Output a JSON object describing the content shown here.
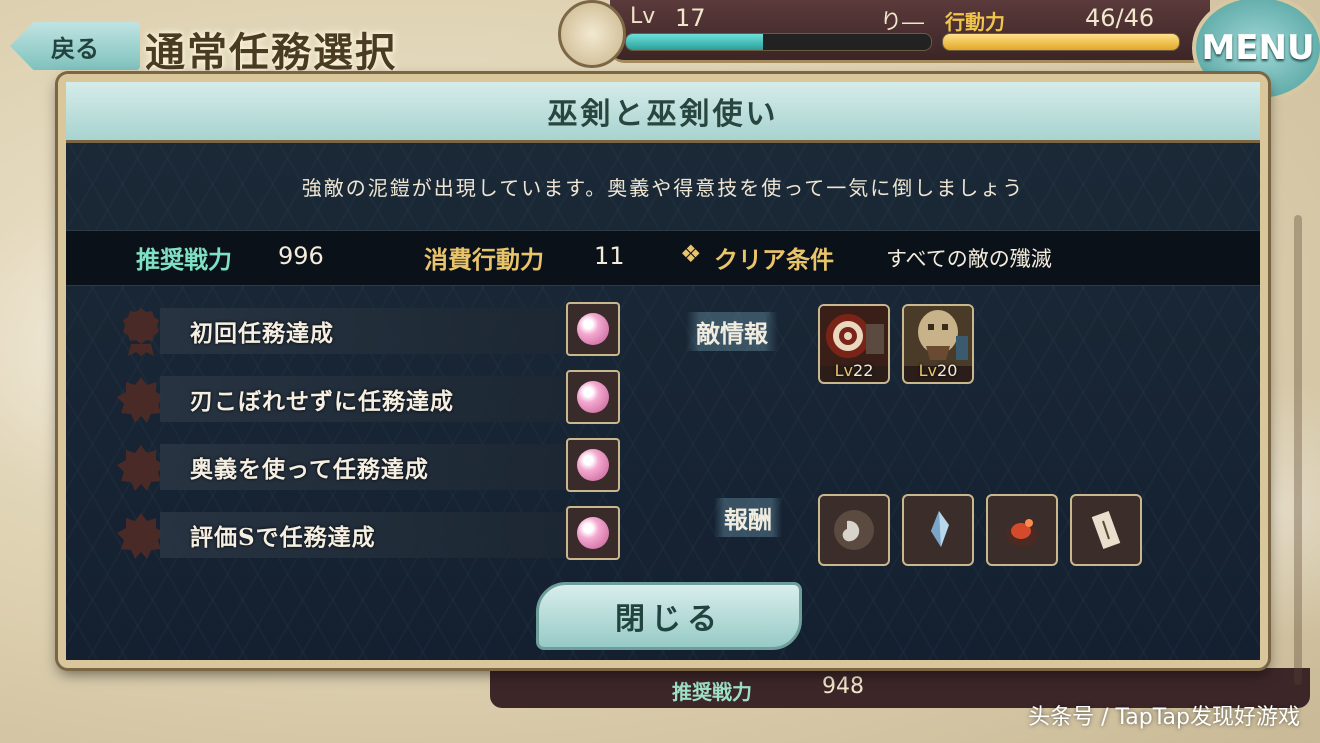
{
  "header": {
    "back_label": "戻る",
    "title": "通常任務選択",
    "level_label": "Lv",
    "level_value": "17",
    "player_name": "り―",
    "ap_label": "行動力",
    "ap_value": "46/46",
    "exp_progress": 0.45,
    "ap_progress": 1.0,
    "menu_label": "MENU"
  },
  "dialog": {
    "title": "巫剣と巫剣使い",
    "description": "強敵の泥鎧が出現しています。奥義や得意技を使って一気に倒しましょう",
    "recommended_power_label": "推奨戦力",
    "recommended_power_value": "996",
    "cost_label": "消費行動力",
    "cost_value": "11",
    "clear_icon": "❖",
    "clear_label": "クリア条件",
    "clear_value": "すべての敵の殲滅",
    "missions": [
      {
        "text": "初回任務達成",
        "reward_icon": "pink-gem-icon"
      },
      {
        "text": "刃こぼれせずに任務達成",
        "reward_icon": "pink-gem-icon"
      },
      {
        "text": "奥義を使って任務達成",
        "reward_icon": "pink-gem-icon"
      },
      {
        "text": "評価Sで任務達成",
        "reward_icon": "pink-gem-icon"
      }
    ],
    "enemy_label": "敵情報",
    "enemies": [
      {
        "lv_prefix": "Lv",
        "lv": "22",
        "icon": "armored-enemy-icon"
      },
      {
        "lv_prefix": "Lv",
        "lv": "20",
        "icon": "masked-enemy-icon"
      }
    ],
    "reward_label": "報酬",
    "rewards": [
      {
        "icon": "magatama-icon"
      },
      {
        "icon": "crystal-shard-icon"
      },
      {
        "icon": "ore-icon"
      },
      {
        "icon": "scroll-icon"
      }
    ],
    "close_label": "閉じる"
  },
  "behind": {
    "recommended_power_label": "推奨戦力",
    "recommended_power_value": "948"
  },
  "watermark": "头条号 / TapTap发现好游戏",
  "colors": {
    "accent_teal": "#a8d3d0",
    "gold": "#e9c46a",
    "power_green": "#7fe0c4",
    "dialog_bg": "#15202c"
  }
}
